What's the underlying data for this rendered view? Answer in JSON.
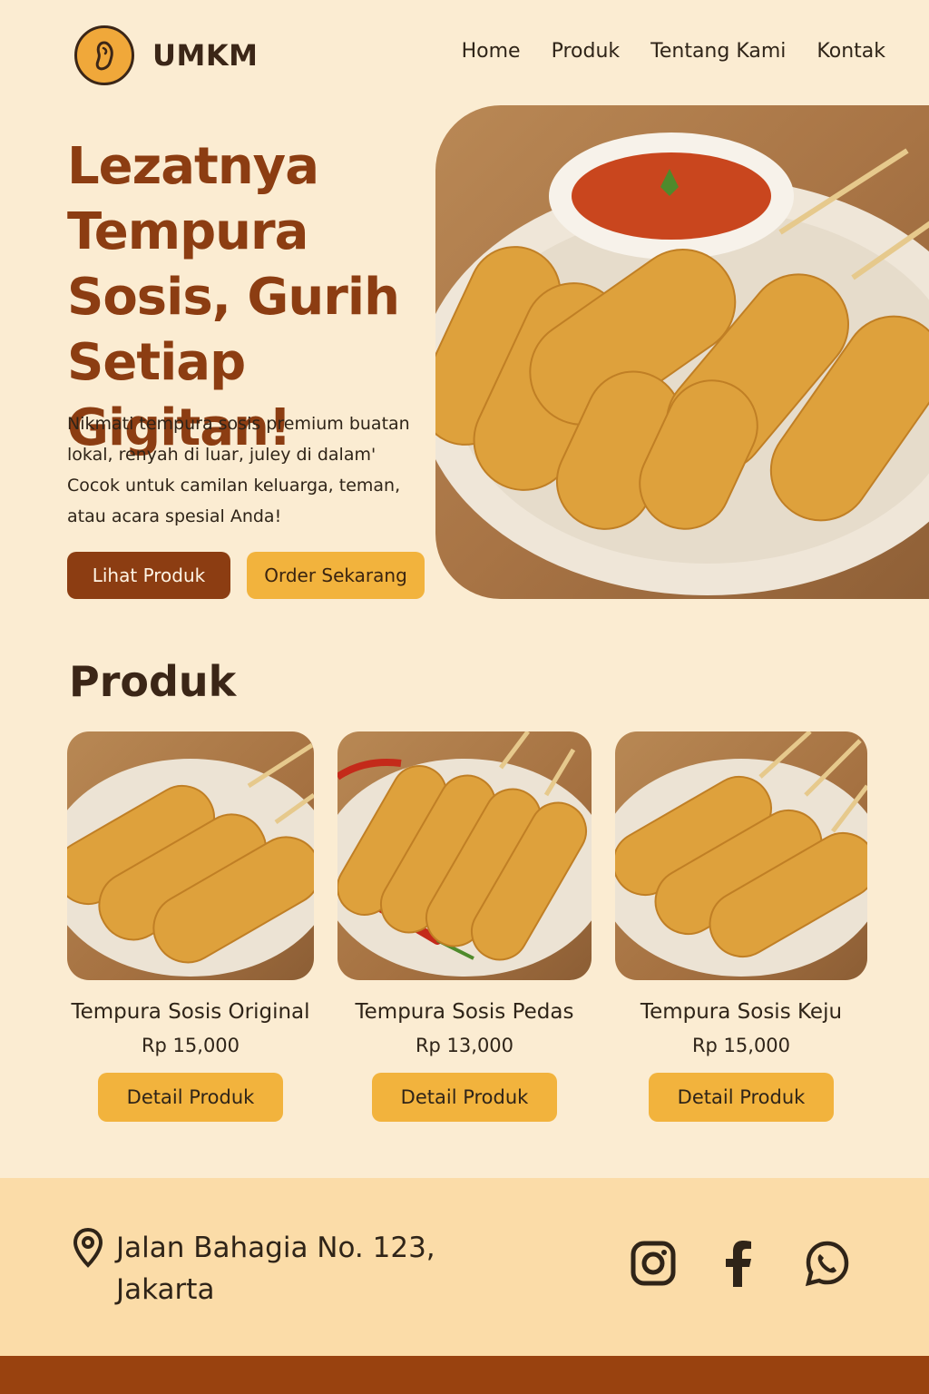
{
  "header": {
    "logo_text": "UMKM",
    "nav": [
      "Home",
      "Produk",
      "Tentang Kami",
      "Kontak"
    ]
  },
  "hero": {
    "title": "Lezatnya Tempura Sosis, Gurih Setiap Gigitan!",
    "description": "Nikmati tempura sosis premium buatan lokal, renyah di luar, juley di dalam' Cocok untuk camilan keluarga, teman, atau acara spesial Anda!",
    "primary_button": "Lihat Produk",
    "secondary_button": "Order Sekarang"
  },
  "products": {
    "title": "Produk",
    "items": [
      {
        "name": "Tempura Sosis Original",
        "price": "Rp 15,000",
        "button": "Detail Produk"
      },
      {
        "name": "Tempura Sosis Pedas",
        "price": "Rp 13,000",
        "button": "Detail Produk"
      },
      {
        "name": "Tempura Sosis Keju",
        "price": "Rp 15,000",
        "button": "Detail Produk"
      }
    ]
  },
  "footer": {
    "address": "Jalan Bahagia No. 123, Jakarta",
    "social": [
      "instagram-icon",
      "facebook-icon",
      "whatsapp-icon"
    ]
  },
  "colors": {
    "background": "#fbecd2",
    "primary_brown": "#8c3d12",
    "accent_orange": "#f2b33d",
    "footer_bg": "#fbdca8",
    "footer_bar": "#99420f"
  }
}
